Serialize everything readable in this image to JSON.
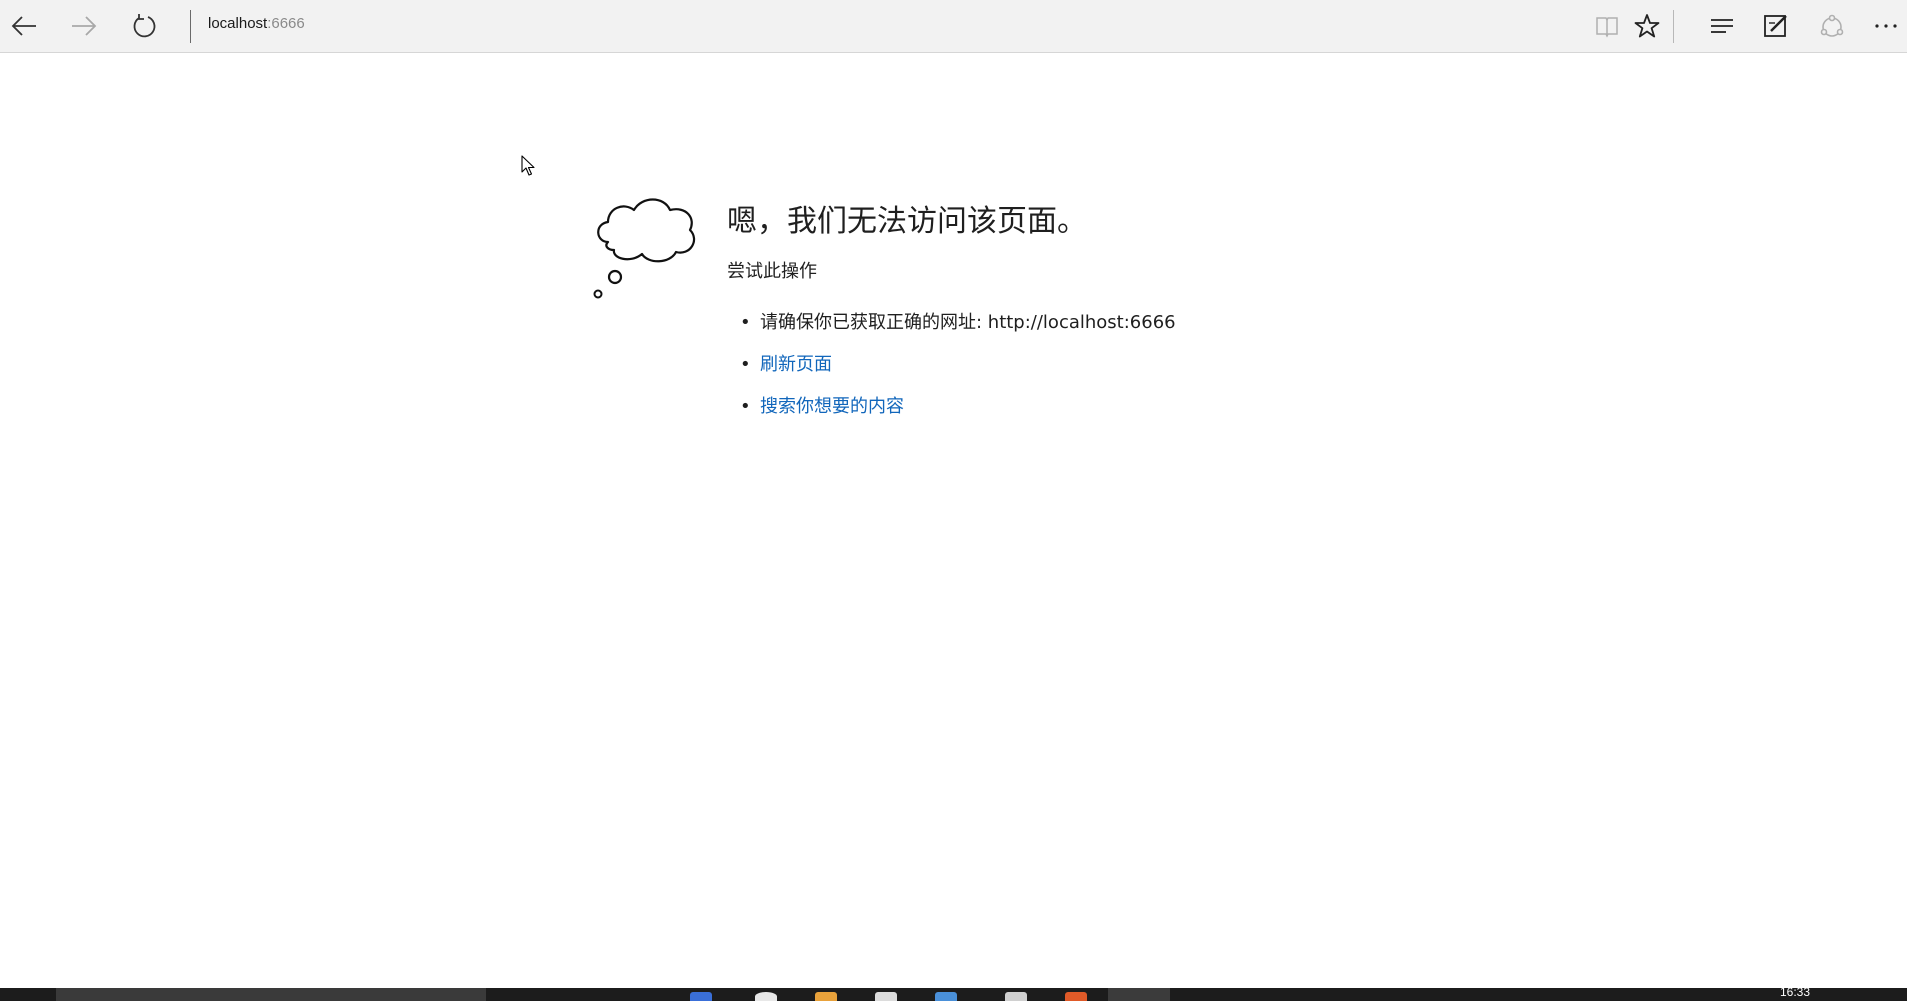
{
  "browser": {
    "address": {
      "host": "localhost",
      "port": ":6666"
    },
    "icons": {
      "back": "back-arrow-icon",
      "forward": "forward-arrow-icon",
      "refresh": "refresh-icon",
      "reading_view": "reading-view-icon",
      "favorite": "star-icon",
      "hub": "hub-icon",
      "web_note": "web-note-icon",
      "share": "share-icon",
      "more": "more-icon"
    }
  },
  "error_page": {
    "title": "嗯，我们无法访问该页面。",
    "try_heading": "尝试此操作",
    "suggestions": [
      "请确保你已获取正确的网址: http://localhost:6666",
      "刷新页面",
      "搜索你想要的内容"
    ],
    "link_color": "#1166bb"
  },
  "taskbar": {
    "clock": "16:33"
  }
}
